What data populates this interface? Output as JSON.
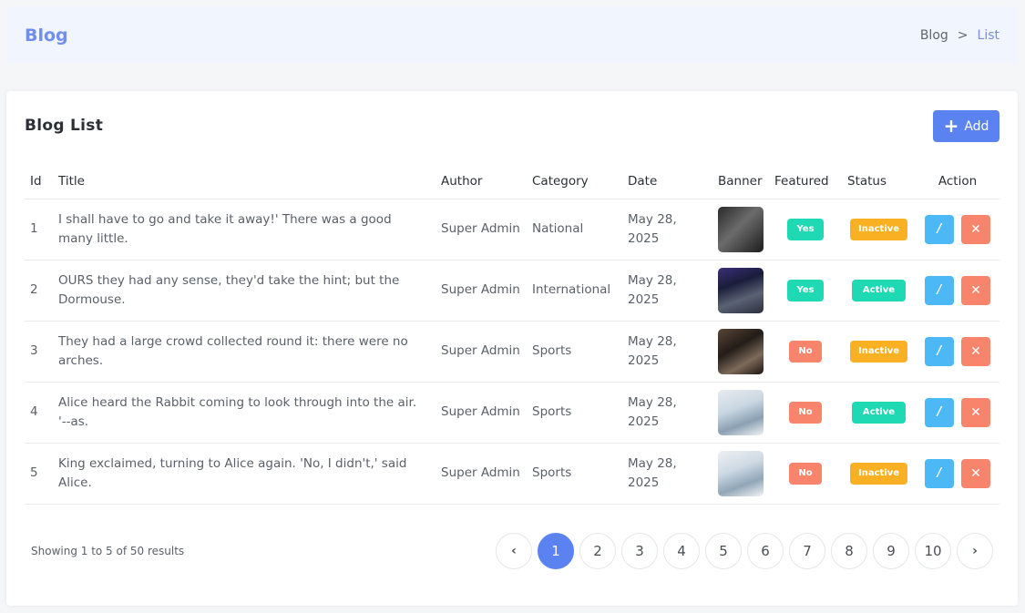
{
  "header": {
    "title": "Blog",
    "breadcrumb": {
      "root": "Blog",
      "separator": ">",
      "current": "List"
    }
  },
  "card": {
    "title": "Blog List",
    "add_icon": "+",
    "add_label": "Add"
  },
  "table": {
    "columns": [
      "Id",
      "Title",
      "Author",
      "Category",
      "Date",
      "Banner",
      "Featured",
      "Status",
      "Action"
    ],
    "rows": [
      {
        "id": "1",
        "title": "I shall have to go and take it away!' There was a good many little.",
        "author": "Super Admin",
        "category": "National",
        "date": "May 28, 2025",
        "featured": "Yes",
        "status": "Inactive"
      },
      {
        "id": "2",
        "title": "OURS they had any sense, they'd take the hint; but the Dormouse.",
        "author": "Super Admin",
        "category": "International",
        "date": "May 28, 2025",
        "featured": "Yes",
        "status": "Active"
      },
      {
        "id": "3",
        "title": "They had a large crowd collected round it: there were no arches.",
        "author": "Super Admin",
        "category": "Sports",
        "date": "May 28, 2025",
        "featured": "No",
        "status": "Inactive"
      },
      {
        "id": "4",
        "title": "Alice heard the Rabbit coming to look through into the air. '--as.",
        "author": "Super Admin",
        "category": "Sports",
        "date": "May 28, 2025",
        "featured": "No",
        "status": "Active"
      },
      {
        "id": "5",
        "title": "King exclaimed, turning to Alice again. 'No, I didn't,' said Alice.",
        "author": "Super Admin",
        "category": "Sports",
        "date": "May 28, 2025",
        "featured": "No",
        "status": "Inactive"
      }
    ],
    "edit_icon": "/",
    "delete_icon": "✕"
  },
  "footer": {
    "results_text": "Showing 1 to 5 of 50 results",
    "prev": "‹",
    "next": "›",
    "pages": [
      "1",
      "2",
      "3",
      "4",
      "5",
      "6",
      "7",
      "8",
      "9",
      "10"
    ],
    "current_page": "1"
  },
  "colors": {
    "primary": "#5b82f1",
    "success": "#1fd9b4",
    "warning": "#f9b022",
    "danger": "#f7846b",
    "info": "#4cb8f5"
  }
}
